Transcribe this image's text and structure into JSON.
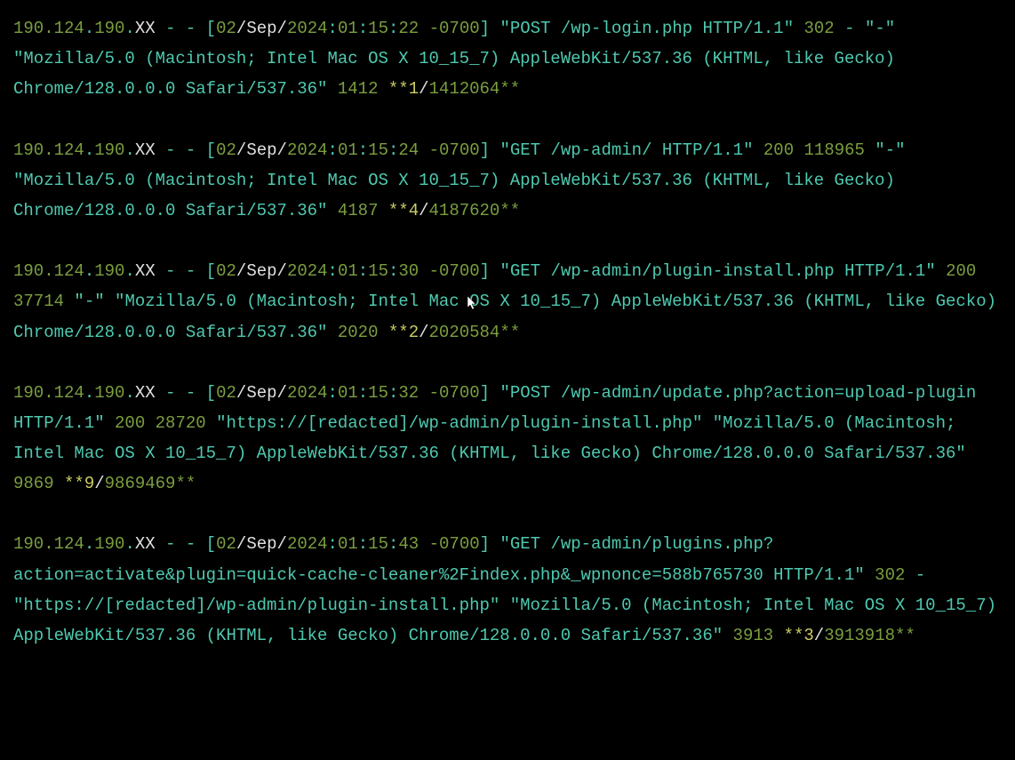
{
  "entries": [
    {
      "ip1": "190.124",
      "ip2": "190",
      "ipxx": "XX",
      "day": "02",
      "month": "Sep",
      "year": "2024",
      "h": "01",
      "m": "15",
      "s": "22",
      "tz": "-0700",
      "request": "\"POST /wp-login.php HTTP/1.1\"",
      "status": "302",
      "size": "-",
      "referer": "\"-\"",
      "ua": "\"Mozilla/5.0 (Macintosh; Intel Mac OS X 10_15_7) AppleWebKit/537.36 (KHTML, like Gecko) Chrome/128.0.0.0 Safari/537.36\"",
      "t1": "1412",
      "b1": "**1",
      "t2": "1412064**"
    },
    {
      "ip1": "190.124",
      "ip2": "190",
      "ipxx": "XX",
      "day": "02",
      "month": "Sep",
      "year": "2024",
      "h": "01",
      "m": "15",
      "s": "24",
      "tz": "-0700",
      "request": "\"GET /wp-admin/ HTTP/1.1\"",
      "status": "200",
      "size": "118965",
      "referer": "\"-\"",
      "ua": "\"Mozilla/5.0 (Macintosh; Intel Mac OS X 10_15_7) AppleWebKit/537.36 (KHTML, like Gecko) Chrome/128.0.0.0 Safari/537.36\"",
      "t1": "4187",
      "b1": "**4",
      "t2": "4187620**"
    },
    {
      "ip1": "190.124",
      "ip2": "190",
      "ipxx": "XX",
      "day": "02",
      "month": "Sep",
      "year": "2024",
      "h": "01",
      "m": "15",
      "s": "30",
      "tz": "-0700",
      "request": "\"GET /wp-admin/plugin-install.php HTTP/1.1\"",
      "status": "200",
      "size": "37714",
      "referer": "\"-\"",
      "ua": "\"Mozilla/5.0 (Macintosh; Intel Mac OS X 10_15_7) AppleWebKit/537.36 (KHTML, like Gecko) Chrome/128.0.0.0 Safari/537.36\"",
      "t1": "2020",
      "b1": "**2",
      "t2": "2020584**"
    },
    {
      "ip1": "190.124",
      "ip2": "190",
      "ipxx": "XX",
      "day": "02",
      "month": "Sep",
      "year": "2024",
      "h": "01",
      "m": "15",
      "s": "32",
      "tz": "-0700",
      "request": "\"POST /wp-admin/update.php?action=upload-plugin HTTP/1.1\"",
      "status": "200",
      "size": "28720",
      "referer": "\"https://[redacted]/wp-admin/plugin-install.php\"",
      "ua": "\"Mozilla/5.0 (Macintosh; Intel Mac OS X 10_15_7) AppleWebKit/537.36 (KHTML, like Gecko) Chrome/128.0.0.0 Safari/537.36\"",
      "t1": "9869",
      "b1": "**9",
      "t2": "9869469**"
    },
    {
      "ip1": "190.124",
      "ip2": "190",
      "ipxx": "XX",
      "day": "02",
      "month": "Sep",
      "year": "2024",
      "h": "01",
      "m": "15",
      "s": "43",
      "tz": "-0700",
      "request": "\"GET /wp-admin/plugins.php?action=activate&plugin=quick-cache-cleaner%2Findex.php&_wpnonce=588b765730 HTTP/1.1\"",
      "status": "302",
      "size": "-",
      "referer": "\"https://[redacted]/wp-admin/plugin-install.php\"",
      "ua": "\"Mozilla/5.0 (Macintosh; Intel Mac OS X 10_15_7) AppleWebKit/537.36 (KHTML, like Gecko) Chrome/128.0.0.0 Safari/537.36\"",
      "t1": "3913",
      "b1": "**3",
      "t2": "3913918**"
    }
  ]
}
